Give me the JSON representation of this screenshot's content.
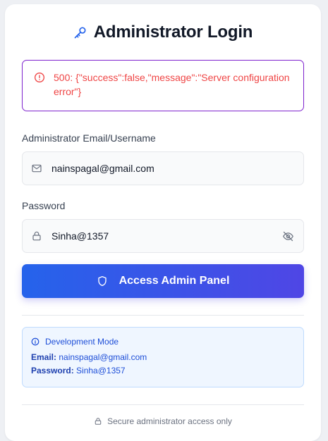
{
  "login": {
    "title": "Administrator Login",
    "title_icon": "key-icon"
  },
  "error": {
    "message": "500: {\"success\":false,\"message\":\"Server configuration error\"}",
    "color": "#ef4444",
    "border_color": "#7e22ce"
  },
  "form": {
    "email_label": "Administrator Email/Username",
    "email_value": "nainspagal@gmail.com",
    "password_label": "Password",
    "password_value": "Sinha@1357",
    "submit_label": "Access Admin Panel",
    "submit_gradient": [
      "#2563eb",
      "#4f46e5"
    ]
  },
  "dev_mode": {
    "title": "Development Mode",
    "email_key": "Email:",
    "email_value": "nainspagal@gmail.com",
    "password_key": "Password:",
    "password_value": "Sinha@1357"
  },
  "footer": {
    "text": "Secure administrator access only"
  }
}
